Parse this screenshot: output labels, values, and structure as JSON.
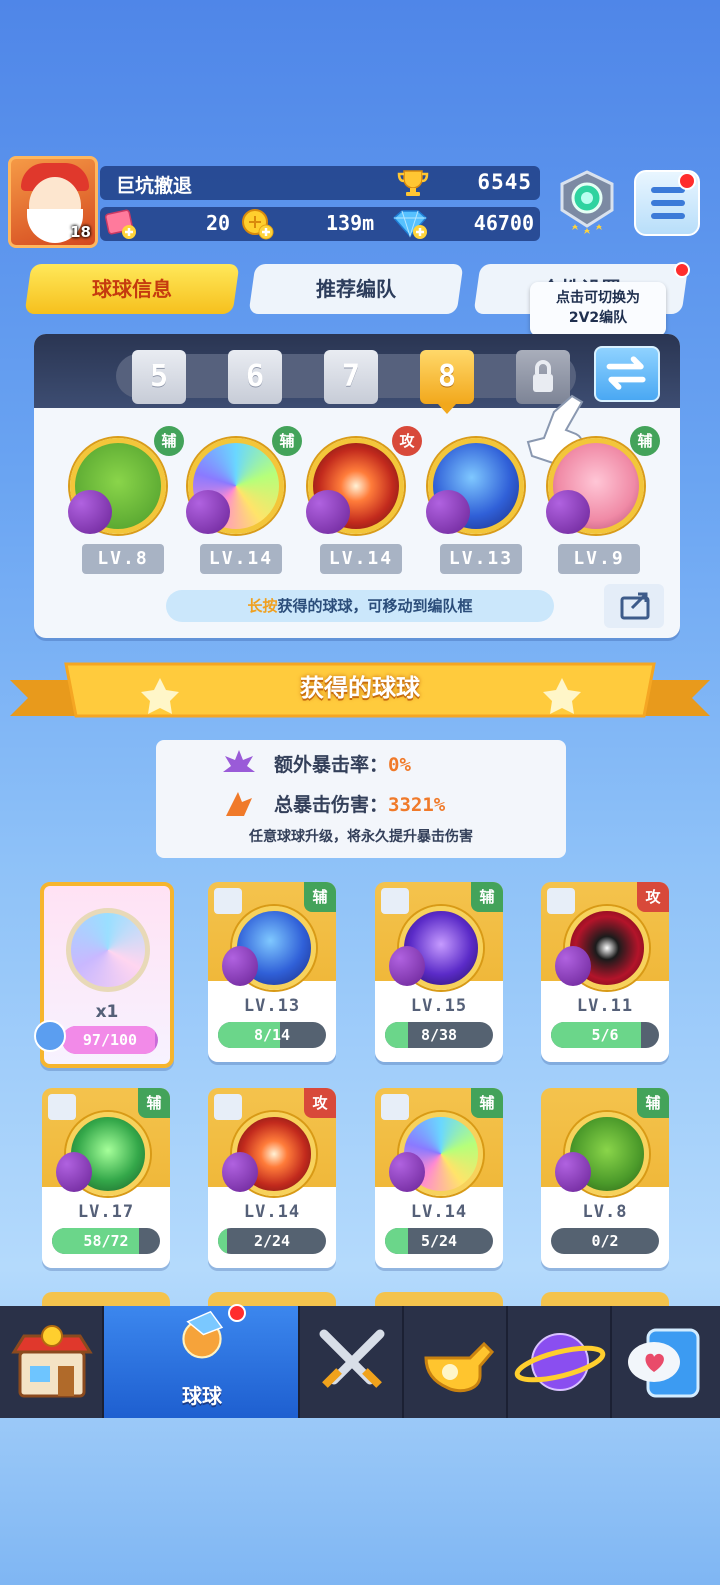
{
  "player": {
    "name": "巨坑撤退",
    "level": "18",
    "trophies": "6545",
    "tickets": "20",
    "coins": "139m",
    "gems": "46700"
  },
  "tabs": [
    "球球信息",
    "推荐编队",
    "个性设置"
  ],
  "tooltip": {
    "line1": "点击可切换为",
    "line2": "2V2编队"
  },
  "team_tabs": [
    "5",
    "6",
    "7",
    "8"
  ],
  "team_tab_active": "8",
  "team": [
    {
      "lv": "LV.8",
      "tag": "辅",
      "tag_type": "sup"
    },
    {
      "lv": "LV.14",
      "tag": "辅",
      "tag_type": "sup"
    },
    {
      "lv": "LV.14",
      "tag": "攻",
      "tag_type": "atk"
    },
    {
      "lv": "LV.13",
      "tag": "",
      "tag_type": "sup"
    },
    {
      "lv": "LV.9",
      "tag": "辅",
      "tag_type": "sup"
    }
  ],
  "hint": {
    "highlight": "长按",
    "rest": "获得的球球，可移动到编队框"
  },
  "banner_title": "获得的球球",
  "stats": {
    "extra_crit_label": "额外暴击率：",
    "extra_crit_value": "0%",
    "total_crit_label": "总暴击伤害：",
    "total_crit_value": "3321%",
    "note": "任意球球升级，将永久提升暴击伤害"
  },
  "special": {
    "count": "x1",
    "progress": "97/100",
    "fraction": 0.97
  },
  "cards": [
    {
      "lv": "LV.13",
      "progress": "8/14",
      "fraction": 0.57,
      "tag": "辅",
      "tag_type": "sup"
    },
    {
      "lv": "LV.15",
      "progress": "8/38",
      "fraction": 0.21,
      "tag": "辅",
      "tag_type": "sup"
    },
    {
      "lv": "LV.11",
      "progress": "5/6",
      "fraction": 0.83,
      "tag": "攻",
      "tag_type": "atk"
    },
    {
      "lv": "LV.17",
      "progress": "58/72",
      "fraction": 0.81,
      "tag": "辅",
      "tag_type": "sup"
    },
    {
      "lv": "LV.14",
      "progress": "2/24",
      "fraction": 0.08,
      "tag": "攻",
      "tag_type": "atk"
    },
    {
      "lv": "LV.14",
      "progress": "5/24",
      "fraction": 0.21,
      "tag": "辅",
      "tag_type": "sup"
    },
    {
      "lv": "LV.8",
      "progress": "0/2",
      "fraction": 0.0,
      "tag": "辅",
      "tag_type": "sup"
    }
  ],
  "nav": {
    "active_label": "球球"
  },
  "colors": {
    "accent": "#f6c01d",
    "support_tag": "#43a35a",
    "attack_tag": "#d8493a",
    "progress_fill": "#6bd68a"
  }
}
